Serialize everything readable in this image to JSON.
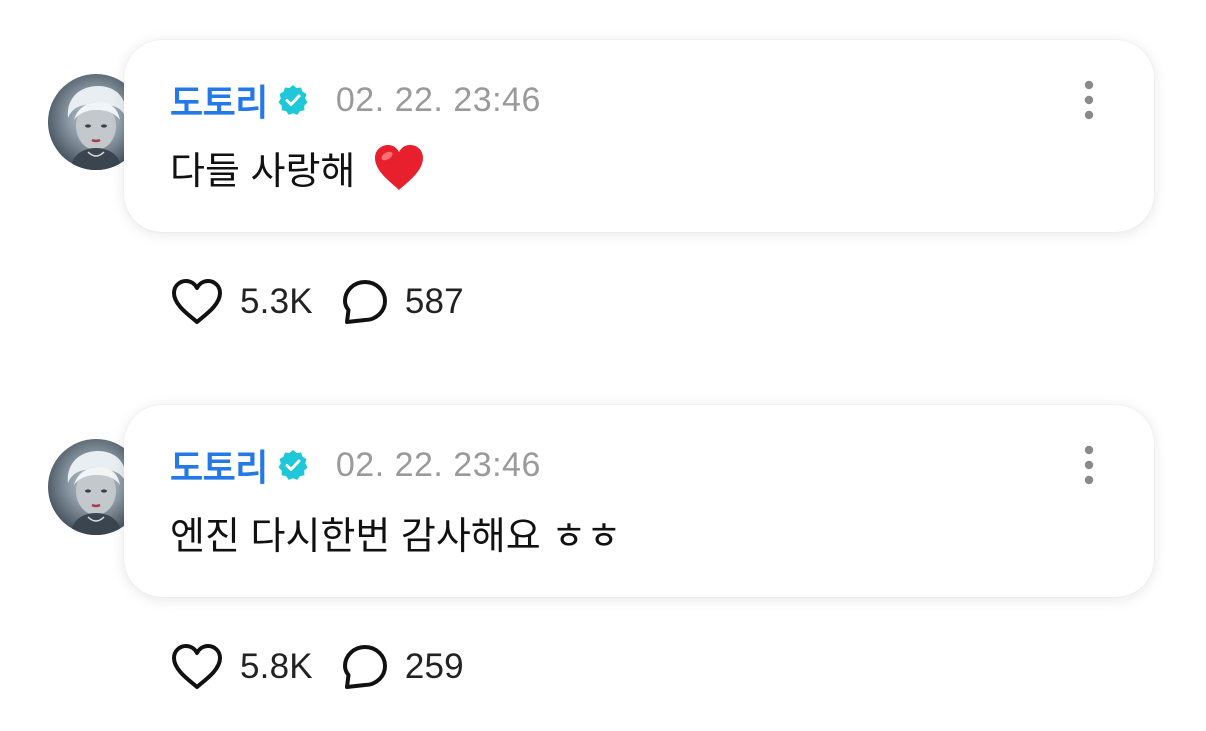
{
  "posts": [
    {
      "username": "도토리",
      "timestamp": "02. 22. 23:46",
      "message": "다들 사랑해",
      "emoji": "red-heart-emoji",
      "likes": "5.3K",
      "comments": "587"
    },
    {
      "username": "도토리",
      "timestamp": "02. 22. 23:46",
      "message": "엔진 다시한번 감사해요 ㅎㅎ",
      "emoji": null,
      "likes": "5.8K",
      "comments": "259"
    }
  ],
  "icons": {
    "verified": "verified-badge-icon",
    "more": "more-vertical-icon",
    "like": "heart-outline-icon",
    "comment": "speech-bubble-icon"
  },
  "colors": {
    "username": "#2478e8",
    "verified_badge": "#1ec8d8",
    "timestamp": "#9a9a9a",
    "text": "#111111",
    "heart_emoji": "#e8202e"
  }
}
